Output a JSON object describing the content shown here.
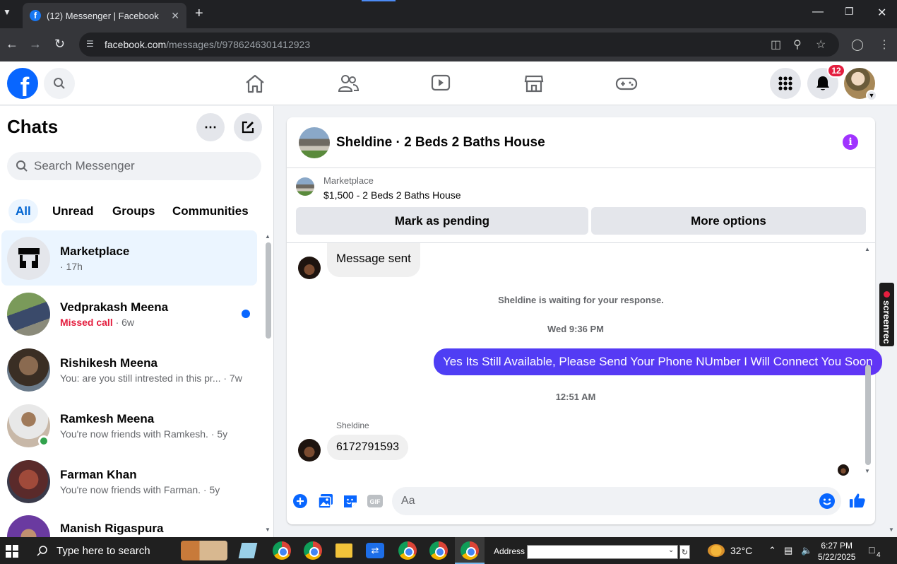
{
  "browser": {
    "tab_title": "(12) Messenger | Facebook",
    "url_domain": "facebook.com",
    "url_path": "/messages/t/9786246301412923"
  },
  "topnav": {
    "notification_count": "12"
  },
  "sidebar": {
    "title": "Chats",
    "search_placeholder": "Search Messenger",
    "filters": [
      "All",
      "Unread",
      "Groups",
      "Communities"
    ],
    "chats": [
      {
        "name": "Marketplace",
        "sub": "· 17h"
      },
      {
        "name": "Vedprakash Meena",
        "missed": "Missed call",
        "sub": " · 6w"
      },
      {
        "name": "Rishikesh Meena",
        "sub": "You: are you still intrested in this pr... · 7w"
      },
      {
        "name": "Ramkesh Meena",
        "sub": "You're now friends with Ramkesh. · 5y"
      },
      {
        "name": "Farman Khan",
        "sub": "You're now friends with Farman. · 5y"
      },
      {
        "name": "Manish Rigaspura",
        "sub": ""
      }
    ]
  },
  "conversation": {
    "title": "Sheldine · 2 Beds 2 Baths House",
    "marketplace_label": "Marketplace",
    "listing": "$1,500 - 2 Beds 2 Baths House",
    "mark_pending": "Mark as pending",
    "more_options": "More options",
    "messages": {
      "sent_notice": "Message sent",
      "waiting": "Sheldine is waiting for your response.",
      "time1": "Wed 9:36 PM",
      "outgoing": "Yes Its Still Available, Please Send Your Phone NUmber I Will Connect You Soon",
      "time2": "12:51 AM",
      "sender": "Sheldine",
      "incoming": "6172791593"
    },
    "composer_placeholder": "Aa"
  },
  "overlay": {
    "screenrec": "screenrec"
  },
  "taskbar": {
    "search_placeholder": "Type here to search",
    "address_label": "Address",
    "temperature": "32°C",
    "time": "6:27 PM",
    "date": "5/22/2025",
    "notifications": "4"
  }
}
